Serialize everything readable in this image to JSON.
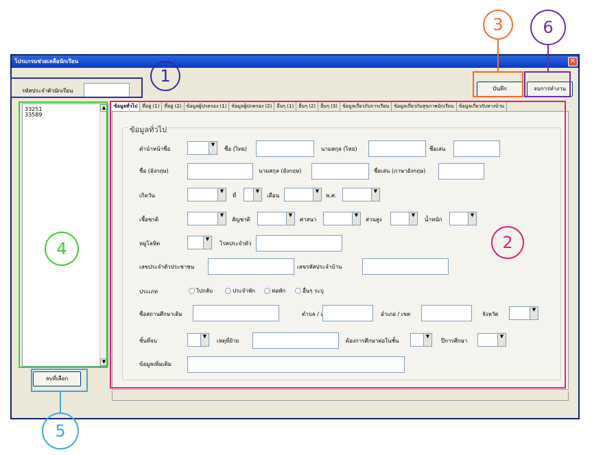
{
  "window": {
    "title": "โปรแกรมช่วยเหลือนักเรียน",
    "close_glyph": "✕"
  },
  "student_id": {
    "label": "รหัสประจำตัวนักเรียน",
    "value": ""
  },
  "toolbar": {
    "save_label": "บันทึก",
    "exit_label": "จบการทำงาน"
  },
  "list": {
    "items": [
      "33251",
      "33589"
    ]
  },
  "delete_label": "ลบที่เลือก",
  "tabs": [
    "ข้อมูลทั่วไป",
    "ที่อยู่ (1)",
    "ที่อยู่ (2)",
    "ข้อมูลผู้ปกครอง (1)",
    "ข้อมูลผู้ปกครอง (2)",
    "อื่นๆ (1)",
    "อื่นๆ (2)",
    "อื่นๆ (3)",
    "ข้อมูลเกี่ยวกับการเรียน",
    "ข้อมูลเกี่ยวกับสุขภาพนักเรียน",
    "ข้อมูลเกี่ยวกับทางบ้าน"
  ],
  "group_title": "ข้อมูลทั่วไป",
  "fields": {
    "prefix": "คำนำหน้าชื่อ",
    "name_th": "ชื่อ (ไทย)",
    "surname_th": "นามสกุล (ไทย)",
    "nickname": "ชื่อเล่น",
    "name_en": "ชื่อ (อังกฤษ)",
    "surname_en": "นามสกุล (อังกฤษ)",
    "nickname_en": "ชื่อเล่น (ภาษาอังกฤษ)",
    "birth": "เกิดวัน",
    "day": "ที่",
    "month": "เดือน",
    "year": "พ.ศ.",
    "race": "เชื้อชาติ",
    "nationality": "สัญชาติ",
    "religion": "ศาสนา",
    "height": "ส่วนสูง",
    "weight": "น้ำหนัก",
    "blood": "หมู่โลหิต",
    "disease": "โรคประจำตัว",
    "citizen_id": "เลขประจำตัวประชาชน",
    "house_id": "เลขรหัสประจำบ้าน",
    "type": "ประเภท",
    "prev_school": "ชื่อสถานศึกษาเดิม",
    "subdistrict": "ตำบล / แขวง",
    "district": "อำเภอ / เขต",
    "province": "จังหวัด",
    "grade_finished": "ชั้นที่จบ",
    "move_reason": "เหตุที่ย้าย",
    "want_grade": "ต้องการศึกษาต่อในชั้น",
    "academic_year": "ปีการศึกษา",
    "extra": "ข้อมูลเพิ่มเติม"
  },
  "type_options": [
    "ไปกลับ",
    "ประจำพัก",
    "หอพัก",
    "อื่นๆ ระบุ"
  ],
  "annotations": [
    "1",
    "2",
    "3",
    "4",
    "5",
    "6"
  ],
  "colors": {
    "a1": "#2e2d9a",
    "a2": "#e0207c",
    "a3": "#f26a2a",
    "a4": "#3ccf2a",
    "a5": "#3ba8dc",
    "a6": "#6b2f9e"
  }
}
